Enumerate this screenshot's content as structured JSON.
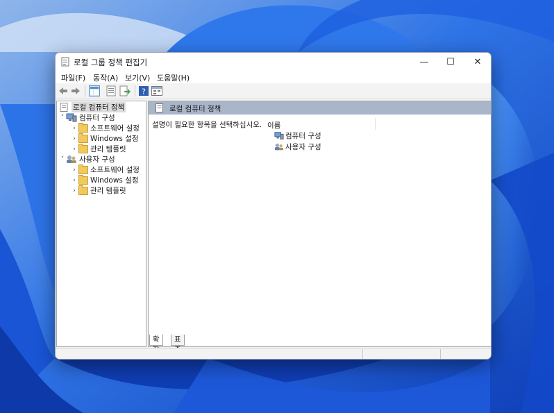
{
  "window": {
    "title": "로컬 그룹 정책 편집기",
    "controls": {
      "minimize": "—",
      "maximize": "☐",
      "close": "✕"
    }
  },
  "menu": [
    {
      "label": "파일(F)"
    },
    {
      "label": "동작(A)"
    },
    {
      "label": "보기(V)"
    },
    {
      "label": "도움말(H)"
    }
  ],
  "toolbar": {
    "buttons": [
      "back-icon",
      "forward-icon",
      "show-hide-tree-icon",
      "properties-icon",
      "export-list-icon",
      "help-icon",
      "show-hide-action-pane-icon"
    ]
  },
  "tree": {
    "root": {
      "label": "로컬 컴퓨터 정책"
    },
    "nodes": [
      {
        "label": "컴퓨터 구성",
        "arrow": "˅"
      },
      {
        "label": "소프트웨어 설정",
        "arrow": "›"
      },
      {
        "label": "Windows 설정",
        "arrow": "›"
      },
      {
        "label": "관리 템플릿",
        "arrow": "›"
      },
      {
        "label": "사용자 구성",
        "arrow": "˅"
      },
      {
        "label": "소프트웨어 설정",
        "arrow": "›"
      },
      {
        "label": "Windows 설정",
        "arrow": "›"
      },
      {
        "label": "관리 템플릿",
        "arrow": "›"
      }
    ]
  },
  "main": {
    "header_title": "로컬 컴퓨터 정책",
    "description": "설명이 필요한 항목을 선택하십시오.",
    "column_header": "이름",
    "items": [
      {
        "label": "컴퓨터 구성"
      },
      {
        "label": "사용자 구성"
      }
    ]
  },
  "tabs": [
    {
      "label": "확장"
    },
    {
      "label": "표준"
    }
  ],
  "colors": {
    "wallpaper": "#1f5fd6",
    "header_bar": "#a9b5c8",
    "folder": "#f2c95d"
  }
}
